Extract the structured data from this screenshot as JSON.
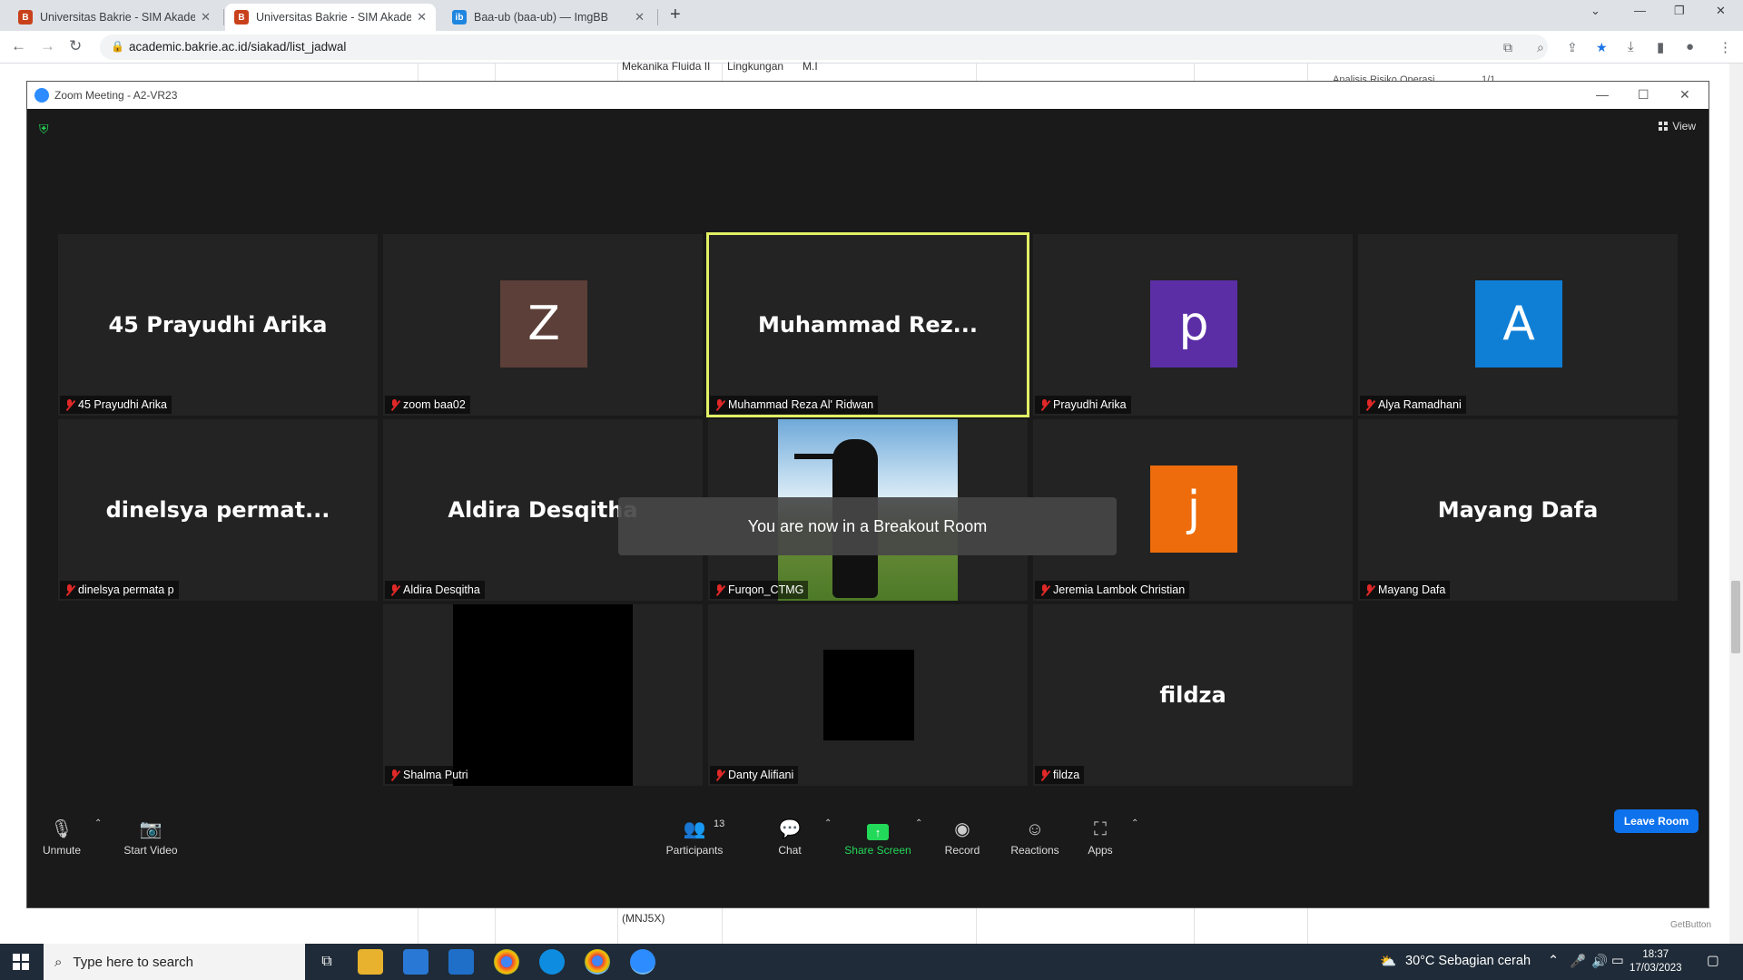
{
  "browser": {
    "tabs": [
      {
        "title": "Universitas Bakrie - SIM Akadem",
        "favicon": "bakrie-favicon-icon",
        "active": false
      },
      {
        "title": "Universitas Bakrie - SIM Akadem",
        "favicon": "bakrie-favicon-icon",
        "active": true
      },
      {
        "title": "Baa-ub (baa-ub) — ImgBB",
        "favicon": "imgbb-favicon-icon",
        "active": false
      }
    ],
    "url": "academic.bakrie.ac.id/siakad/list_jadwal"
  },
  "background_page": {
    "header_cells": [
      "Mekanika Fluida II",
      "Lingkungan",
      "M.I"
    ],
    "find_bar_text": "Analisis Risiko Operasi",
    "find_bar_count": "1/1",
    "bottom_cell": "(MNJ5X)",
    "getbutton": "GetButton"
  },
  "zoom": {
    "window_title": "Zoom Meeting - A2-VR23",
    "view_label": "View",
    "toast": "You are now in a Breakout Room",
    "tiles": [
      {
        "display": "45 Prayudhi Arika",
        "label": "45 Prayudhi Arika"
      },
      {
        "display": "Z",
        "label": "zoom baa02",
        "avatar_color": "#5c3f38"
      },
      {
        "display": "Muhammad  Rez...",
        "label": "Muhammad Reza Al' Ridwan",
        "active_speaker": true
      },
      {
        "display": "p",
        "label": "Prayudhi Arika",
        "avatar_color": "#5b2ea6"
      },
      {
        "display": "A",
        "label": "Alya Ramadhani",
        "avatar_color": "#0f7fd6"
      },
      {
        "display": "dinelsya  permat...",
        "label": "dinelsya permata p"
      },
      {
        "display": "Aldira Desqitha",
        "label": "Aldira Desqitha"
      },
      {
        "display": "",
        "label": "Furqon_CTMG"
      },
      {
        "display": "j",
        "label": "Jeremia Lambok Christian",
        "avatar_color": "#ee6c0b"
      },
      {
        "display": "Mayang Dafa",
        "label": "Mayang Dafa"
      },
      {
        "display": "",
        "label": "Shalma Putri"
      },
      {
        "display": "",
        "label": "Danty Alifiani"
      },
      {
        "display": "fildza",
        "label": "fildza"
      }
    ],
    "controls": {
      "unmute": "Unmute",
      "start_video": "Start Video",
      "participants": "Participants",
      "participants_count": "13",
      "chat": "Chat",
      "share_screen": "Share Screen",
      "record": "Record",
      "reactions": "Reactions",
      "apps": "Apps",
      "leave_room": "Leave Room"
    }
  },
  "taskbar": {
    "search_placeholder": "Type here to search",
    "weather": "30°C  Sebagian cerah",
    "time": "18:37",
    "date": "17/03/2023"
  }
}
